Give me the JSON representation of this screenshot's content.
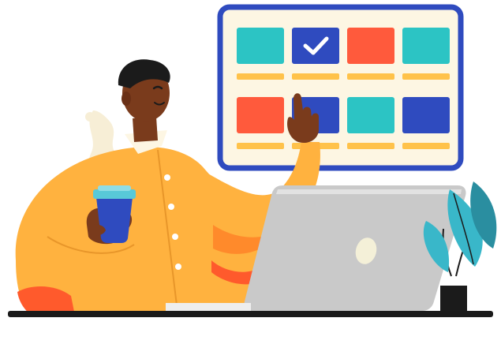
{
  "scene": {
    "subject": "person-pointing-at-calendar-with-laptop",
    "icons": [
      "calendar-board-icon",
      "checkmark-icon",
      "laptop-icon",
      "coffee-cup-icon",
      "potted-plant-icon"
    ]
  },
  "calendar": {
    "rows": [
      [
        {
          "color": "#2cc4c4",
          "checked": false
        },
        {
          "color": "#2f4bbf",
          "checked": true
        },
        {
          "color": "#ff5a3c",
          "checked": false
        },
        {
          "color": "#2cc4c4",
          "checked": false
        }
      ],
      [
        {
          "color": "#ff5a3c",
          "checked": false
        },
        {
          "color": "#2f4bbf",
          "checked": false
        },
        {
          "color": "#2cc4c4",
          "checked": false
        },
        {
          "color": "#2f4bbf",
          "checked": false
        }
      ]
    ],
    "frame_color": "#2f4bbf",
    "board_color": "#fdf6e3",
    "bar_color": "#ffc24a"
  },
  "colors": {
    "shirt": "#ffb23f",
    "shirt_shadow": "#ff8a2b",
    "accent": "#ff5a2c",
    "skin": "#7a3b1c",
    "hair": "#1b1b1b",
    "laptop": "#c9c9c9",
    "laptop_dark": "#a9a9a9",
    "desk": "#1a1a1a",
    "cup": "#2f4bbf",
    "cup_lid": "#58c9d8",
    "plant": "#39b7c9",
    "plant_dark": "#2a8ea0",
    "steam": "#f7eed6"
  }
}
